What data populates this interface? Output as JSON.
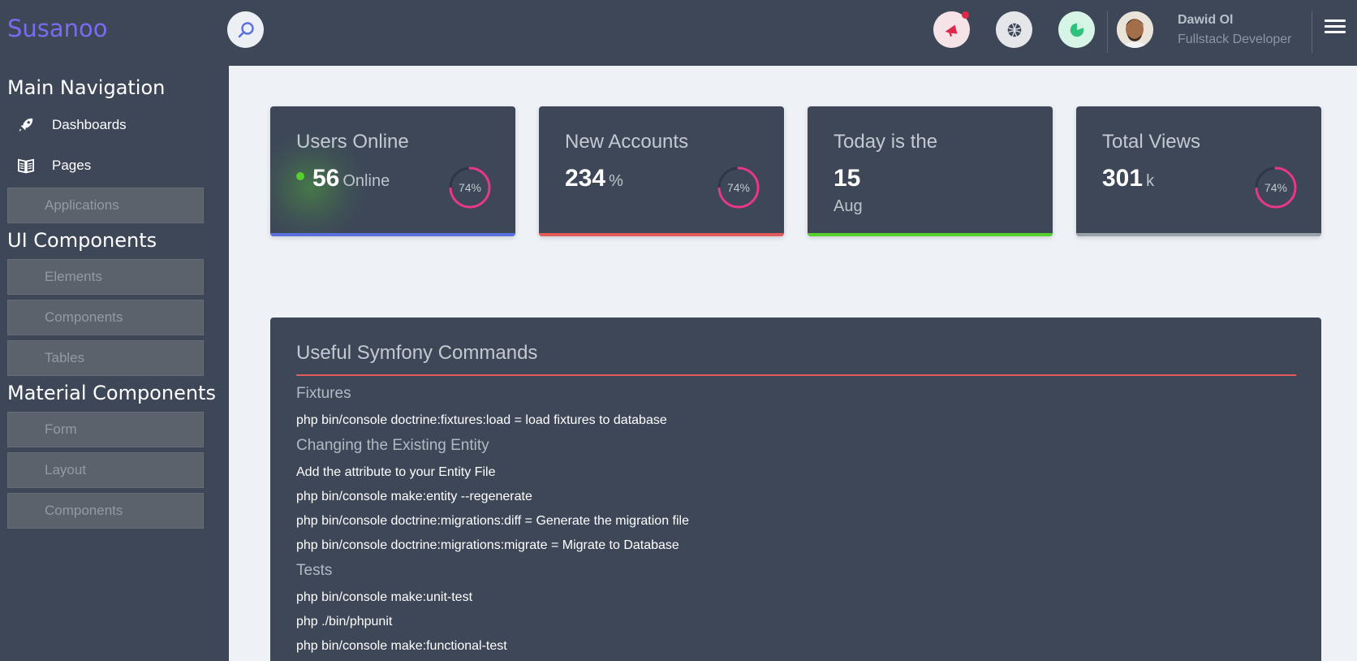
{
  "brand": "Susanoo",
  "header": {
    "user_name": "Dawid Ol",
    "user_role": "Fullstack Developer",
    "icons": [
      "search-icon",
      "megaphone-icon",
      "globe-icon",
      "pie-chart-icon",
      "menu-icon"
    ]
  },
  "sidebar": {
    "sections": [
      {
        "heading": "Main Navigation"
      },
      {
        "heading": "UI Components"
      },
      {
        "heading": "Material Components"
      }
    ],
    "items": [
      {
        "label": "Dashboards",
        "icon": "rocket-icon"
      },
      {
        "label": "Pages",
        "icon": "book-icon"
      },
      {
        "label": "Applications"
      },
      {
        "label": "Elements"
      },
      {
        "label": "Components"
      },
      {
        "label": "Tables"
      },
      {
        "label": "Form"
      },
      {
        "label": "Layout"
      },
      {
        "label": "Components"
      }
    ]
  },
  "cards": [
    {
      "title": "Users Online",
      "value": "56",
      "unit": "Online",
      "percent_label": "74%",
      "percent": 0.74,
      "bar_color": "#5a6fe0"
    },
    {
      "title": "New Accounts",
      "value": "234",
      "unit": "%",
      "percent_label": "74%",
      "percent": 0.74,
      "bar_color": "#e55a5a"
    },
    {
      "title": "Today is the",
      "value": "15",
      "sub": "Aug",
      "bar_color": "#56d02c"
    },
    {
      "title": "Total Views",
      "value": "301",
      "unit": "k",
      "percent_label": "74%",
      "percent": 0.74,
      "bar_color": "#9aa0a8"
    }
  ],
  "colors": {
    "ring": "#e8388a",
    "ring_track": "#2f3746",
    "brand": "#7a6bf0"
  },
  "panel": {
    "title": "Useful Symfony Commands",
    "sections": [
      {
        "heading": "Fixtures",
        "lines": [
          "php bin/console doctrine:fixtures:load = load fixtures to database"
        ]
      },
      {
        "heading": "Changing the Existing Entity",
        "lines": [
          "Add the attribute to your Entity File",
          "php bin/console make:entity --regenerate",
          "php bin/console doctrine:migrations:diff = Generate the migration file",
          "php bin/console doctrine:migrations:migrate = Migrate to Database"
        ]
      },
      {
        "heading": "Tests",
        "lines": [
          "php bin/console make:unit-test",
          "php ./bin/phpunit",
          "php bin/console make:functional-test"
        ]
      }
    ]
  }
}
